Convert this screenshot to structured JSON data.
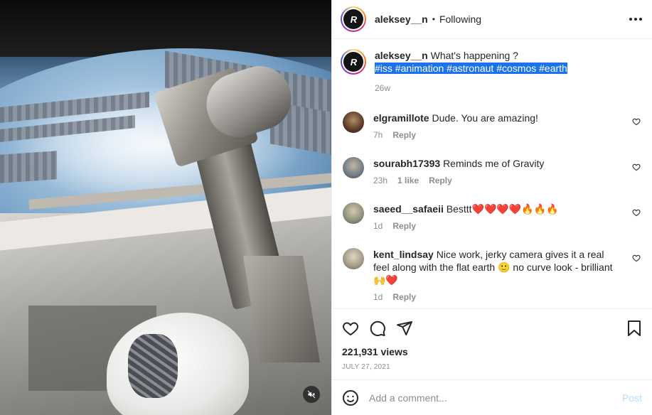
{
  "post": {
    "username": "aleksey__n",
    "separator": "•",
    "follow_status": "Following",
    "logo_text": "R"
  },
  "caption": {
    "username": "aleksey__n",
    "text": "What's happening ?",
    "hashtags": "#iss #animation #astronaut #cosmos #earth",
    "age": "26w"
  },
  "comments": [
    {
      "username": "elgramillote",
      "text": "Dude. You are amazing!",
      "age": "7h",
      "likes": "",
      "reply": "Reply",
      "avatar_color": "#5a3a28"
    },
    {
      "username": "sourabh17393",
      "text": "Reminds me of Gravity",
      "age": "23h",
      "likes": "1 like",
      "reply": "Reply",
      "avatar_color": "#6f7c86"
    },
    {
      "username": "saeed__safaeii",
      "text": "Besttt❤️❤️❤️❤️🔥🔥🔥",
      "age": "1d",
      "likes": "",
      "reply": "Reply",
      "avatar_color": "#8d8f7a"
    },
    {
      "username": "kent_lindsay",
      "text": "Nice work, jerky camera gives it a real feel along with the flat earth 🙂 no curve look - brilliant 🙌❤️",
      "age": "1d",
      "likes": "",
      "reply": "Reply",
      "avatar_color": "#a39a85"
    }
  ],
  "stats": {
    "views": "221,931 views",
    "date": "JULY 27, 2021"
  },
  "composer": {
    "placeholder": "Add a comment...",
    "post_label": "Post"
  },
  "icons": {
    "like": "heart-icon",
    "comment": "comment-icon",
    "share": "share-icon",
    "save": "bookmark-icon",
    "emoji": "emoji-icon",
    "mute": "speaker-muted-icon",
    "more": "more-options-icon"
  },
  "colors": {
    "hashtag_highlight": "#1c72e8",
    "post_disabled": "#b2dffc",
    "meta_gray": "#8e8e8e"
  }
}
